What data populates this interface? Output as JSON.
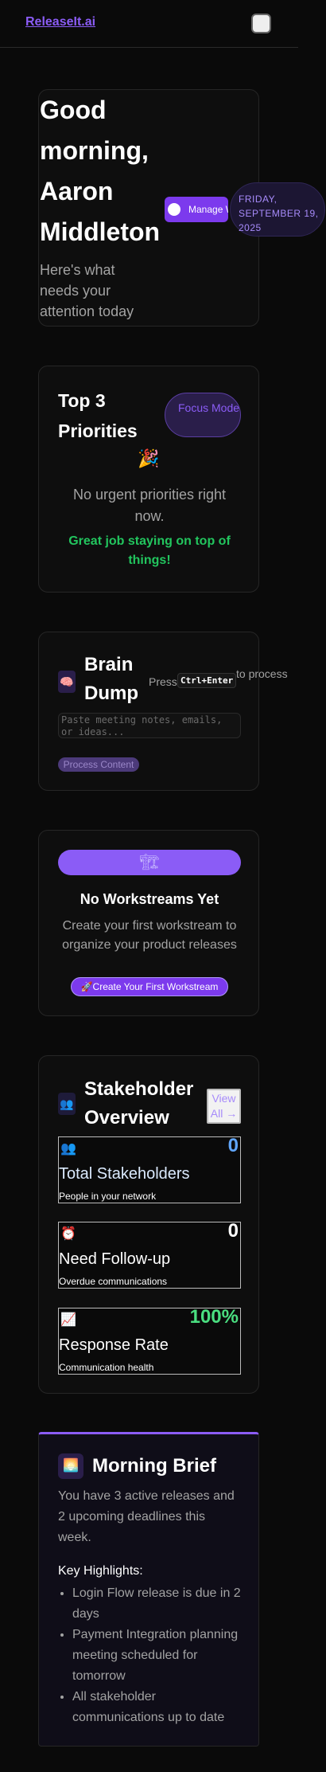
{
  "header": {
    "logo": "ReleaseIt.ai"
  },
  "greeting": {
    "title": "Good morning, Aaron Middleton",
    "subtitle": "Here's what needs your attention today",
    "manage_button": "Manage Workstreams",
    "date": "FRIDAY, SEPTEMBER 19, 2025"
  },
  "priorities": {
    "title": "Top 3 Priorities",
    "focus_button": "Focus Mode",
    "icon": "party-popper-icon",
    "empty_text": "No urgent priorities right now.",
    "great_text": "Great job staying on top of things!"
  },
  "brain_dump": {
    "icon": "brain-icon",
    "title": "Brain Dump",
    "press_label": "Press",
    "shortcut": "Ctrl+Enter",
    "process_hint": "to process",
    "placeholder": "Paste meeting notes, emails, or ideas...",
    "process_button": "Process Content"
  },
  "workstreams": {
    "icon": "construction-icon",
    "title": "No Workstreams Yet",
    "description": "Create your first workstream to organize your product releases",
    "create_button": "🚀Create Your First Workstream"
  },
  "stakeholders": {
    "icon": "people-icon",
    "title": "Stakeholder Overview",
    "view_all": "View All →",
    "stats": [
      {
        "icon": "people-icon",
        "value": "0",
        "name": "Total Stakeholders",
        "desc": "People in your network",
        "color": "#60a5fa"
      },
      {
        "icon": "alarm-clock-icon",
        "value": "0",
        "name": "Need Follow-up",
        "desc": "Overdue communications",
        "color": "#ffffff"
      },
      {
        "icon": "chart-up-icon",
        "value": "100%",
        "name": "Response Rate",
        "desc": "Communication health",
        "color": "#4ade80"
      }
    ]
  },
  "brief": {
    "icon": "sunrise-icon",
    "title": "Morning Brief",
    "summary": "You have 3 active releases and 2 upcoming deadlines this week.",
    "highlights_heading": "Key Highlights:",
    "highlights": [
      "Login Flow release is due in 2 days",
      "Payment Integration planning meeting scheduled for tomorrow",
      "All stakeholder communications up to date"
    ]
  }
}
